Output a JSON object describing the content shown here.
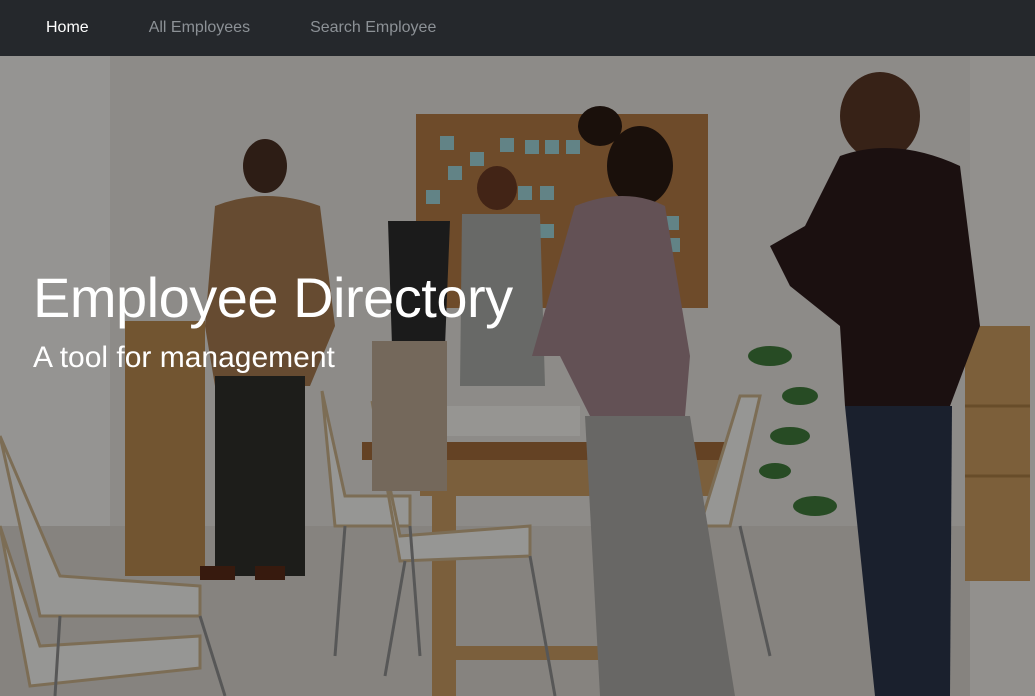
{
  "nav": {
    "items": [
      {
        "label": "Home",
        "active": true
      },
      {
        "label": "All Employees",
        "active": false
      },
      {
        "label": "Search Employee",
        "active": false
      }
    ]
  },
  "hero": {
    "title": "Employee Directory",
    "subtitle": "A tool for management",
    "image_description": "office photo background"
  },
  "colors": {
    "navbar_bg": "#25282c",
    "nav_active": "#ffffff",
    "nav_inactive": "#8c9196",
    "hero_text": "#ffffff"
  }
}
